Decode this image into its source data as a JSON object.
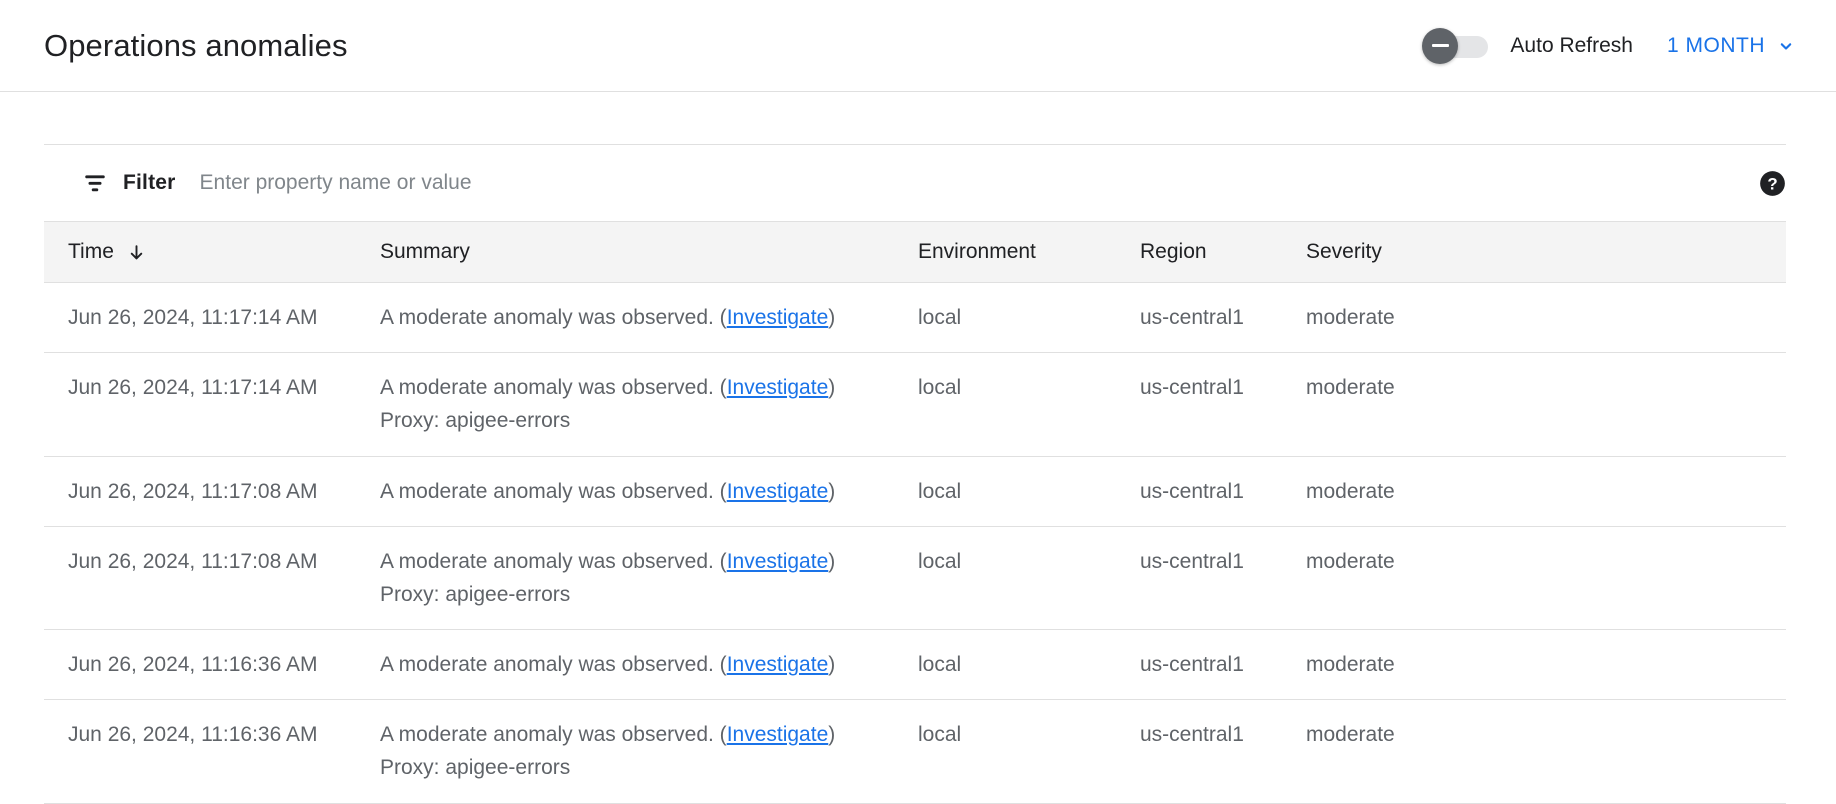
{
  "header": {
    "title": "Operations anomalies",
    "auto_refresh_label": "Auto Refresh",
    "auto_refresh_on": false,
    "time_range": "1 MONTH",
    "accent_color": "#1a73e8"
  },
  "filter": {
    "label": "Filter",
    "placeholder": "Enter property name or value",
    "value": "",
    "icon": "filter-icon",
    "help_icon": "help-icon"
  },
  "table": {
    "columns": [
      {
        "key": "time",
        "label": "Time",
        "sorted": true,
        "sort_direction": "desc"
      },
      {
        "key": "summary",
        "label": "Summary",
        "sorted": false
      },
      {
        "key": "environment",
        "label": "Environment",
        "sorted": false
      },
      {
        "key": "region",
        "label": "Region",
        "sorted": false
      },
      {
        "key": "severity",
        "label": "Severity",
        "sorted": false
      }
    ],
    "rows": [
      {
        "time": "Jun 26, 2024, 11:17:14 AM",
        "summary_prefix": "A moderate anomaly was observed. (",
        "summary_link": "Investigate",
        "summary_suffix": ")",
        "summary_detail": "",
        "environment": "local",
        "region": "us-central1",
        "severity": "moderate"
      },
      {
        "time": "Jun 26, 2024, 11:17:14 AM",
        "summary_prefix": "A moderate anomaly was observed. (",
        "summary_link": "Investigate",
        "summary_suffix": ")",
        "summary_detail": "Proxy: apigee-errors",
        "environment": "local",
        "region": "us-central1",
        "severity": "moderate"
      },
      {
        "time": "Jun 26, 2024, 11:17:08 AM",
        "summary_prefix": "A moderate anomaly was observed. (",
        "summary_link": "Investigate",
        "summary_suffix": ")",
        "summary_detail": "",
        "environment": "local",
        "region": "us-central1",
        "severity": "moderate"
      },
      {
        "time": "Jun 26, 2024, 11:17:08 AM",
        "summary_prefix": "A moderate anomaly was observed. (",
        "summary_link": "Investigate",
        "summary_suffix": ")",
        "summary_detail": "Proxy: apigee-errors",
        "environment": "local",
        "region": "us-central1",
        "severity": "moderate"
      },
      {
        "time": "Jun 26, 2024, 11:16:36 AM",
        "summary_prefix": "A moderate anomaly was observed. (",
        "summary_link": "Investigate",
        "summary_suffix": ")",
        "summary_detail": "",
        "environment": "local",
        "region": "us-central1",
        "severity": "moderate"
      },
      {
        "time": "Jun 26, 2024, 11:16:36 AM",
        "summary_prefix": "A moderate anomaly was observed. (",
        "summary_link": "Investigate",
        "summary_suffix": ")",
        "summary_detail": "Proxy: apigee-errors",
        "environment": "local",
        "region": "us-central1",
        "severity": "moderate"
      }
    ]
  }
}
